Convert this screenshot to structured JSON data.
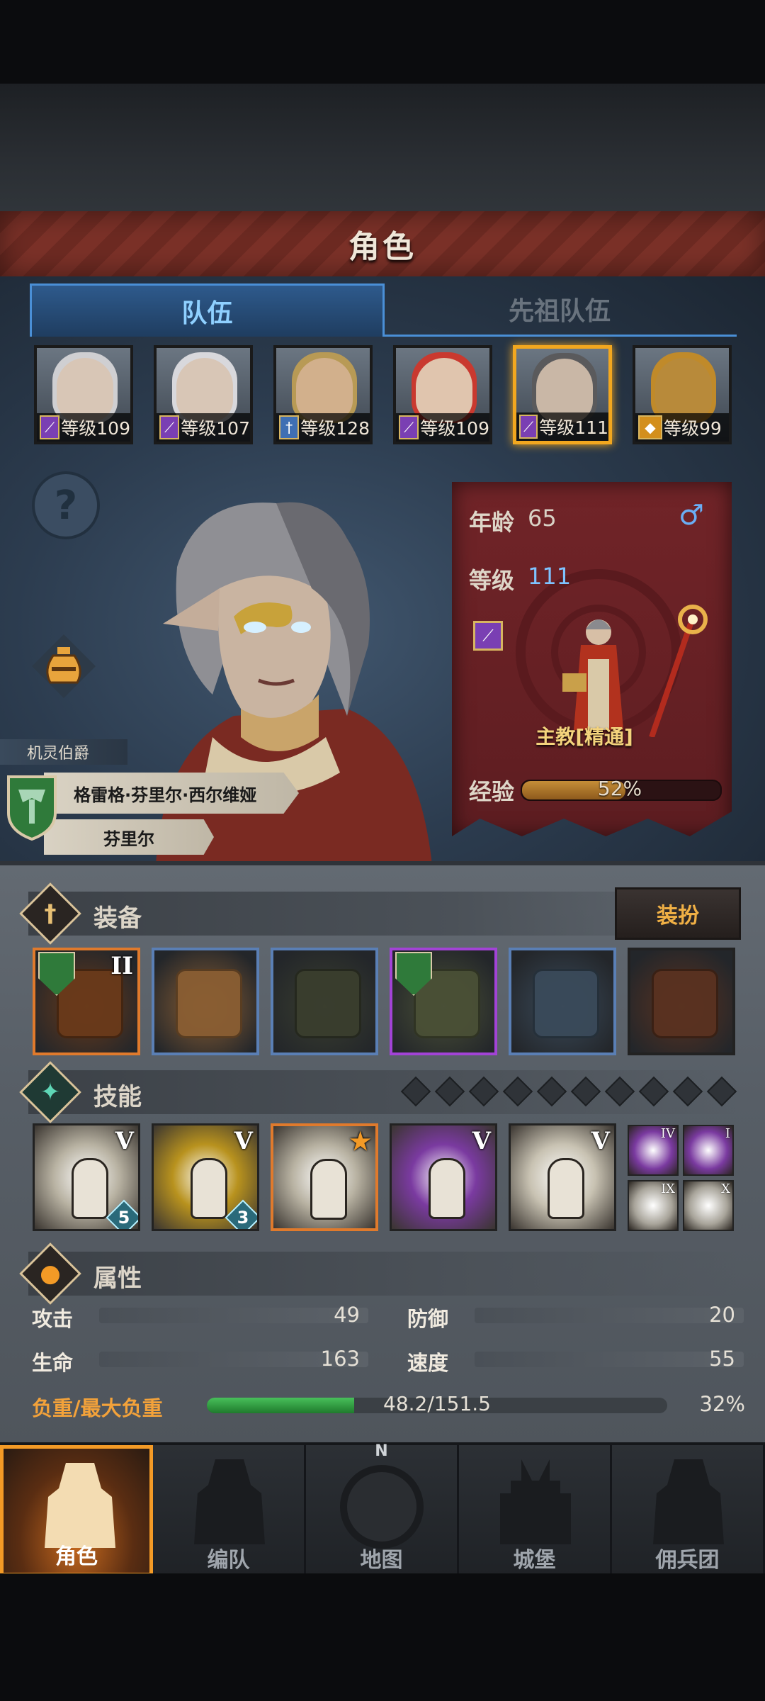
{
  "header": {
    "title": "角色"
  },
  "tabs": [
    {
      "label": "队伍",
      "active": true
    },
    {
      "label": "先祖队伍",
      "active": false
    }
  ],
  "roster": [
    {
      "level": "等级109",
      "class_icon": "staff-icon",
      "face": "#d8c6b6",
      "hair": "#cfcfd2"
    },
    {
      "level": "等级107",
      "class_icon": "staff-icon",
      "face": "#d8c6b6",
      "hair": "#d8d8dc"
    },
    {
      "level": "等级128",
      "class_icon": "sword-icon",
      "face": "#d2b08c",
      "hair": "#b89a55"
    },
    {
      "level": "等级109",
      "class_icon": "staff-icon",
      "face": "#e0c5ae",
      "hair": "#c9392f"
    },
    {
      "level": "等级111",
      "class_icon": "staff-icon",
      "face": "#c9b7a6",
      "hair": "#5a5a5c",
      "selected": true
    },
    {
      "level": "等级99",
      "class_icon": "shield-icon",
      "face": "#b88a3a",
      "hair": "#c08a2a"
    }
  ],
  "character": {
    "rank": "机灵伯爵",
    "full_name": "格雷格·芬里尔·西尔维娅",
    "short_name": "芬里尔",
    "age_label": "年龄",
    "age": "65",
    "level_label": "等级",
    "level": "111",
    "class_name": "主教[精通]",
    "exp_label": "经验",
    "exp_percent": "52%",
    "exp_fraction": 0.52,
    "gender_icon": "male-symbol-icon"
  },
  "equipment": {
    "title": "装备",
    "outfit_button": "装扮",
    "slots": [
      {
        "name": "staff",
        "rank": "II",
        "border": "#e07a2c",
        "bg": "#6a3a1a"
      },
      {
        "name": "wooden-box",
        "rank": "",
        "border": "#5a7fb5",
        "bg": "#8a5e33"
      },
      {
        "name": "hood",
        "rank": "",
        "border": "#5a7fb5",
        "bg": "#3a3e2e"
      },
      {
        "name": "fur-armor",
        "rank": "",
        "border": "#a243d6",
        "bg": "#4a5036"
      },
      {
        "name": "boots",
        "rank": "",
        "border": "#5a7fb5",
        "bg": "#3a4a5a"
      },
      {
        "name": "book",
        "rank": "",
        "border": "#222222",
        "bg": "#5a3220"
      }
    ]
  },
  "skills": {
    "title": "技能",
    "points": 10,
    "slots": [
      {
        "name": "spear-summon",
        "rank": "V",
        "badge": "5",
        "bg": "#b8b2a2"
      },
      {
        "name": "holy-shield",
        "rank": "V",
        "badge": "3",
        "bg": "#b8921e"
      },
      {
        "name": "crystal-summon",
        "rank": "★",
        "badge": "",
        "bg": "#b8b2a2",
        "border": "#e07a2c"
      },
      {
        "name": "crystal-prayer-purple",
        "rank": "V",
        "badge": "",
        "bg": "#7a3aa0"
      },
      {
        "name": "crystal-prayer",
        "rank": "V",
        "badge": "",
        "bg": "#c8c2b2"
      }
    ],
    "passives": [
      {
        "name": "shield-passive",
        "rank": "IV",
        "bg": "#7a3aa0"
      },
      {
        "name": "staff-passive",
        "rank": "I",
        "bg": "#7a3aa0"
      },
      {
        "name": "burst-passive",
        "rank": "IX",
        "bg": "#a8a49a"
      },
      {
        "name": "explosion-passive",
        "rank": "X",
        "bg": "#a8a49a"
      }
    ]
  },
  "attributes": {
    "title": "属性",
    "attack_label": "攻击",
    "attack": "49",
    "defense_label": "防御",
    "defense": "20",
    "hp_label": "生命",
    "hp": "163",
    "speed_label": "速度",
    "speed": "55",
    "weight_label": "负重/最大负重",
    "weight": "48.2/151.5",
    "weight_percent": "32%",
    "weight_fraction": 0.32
  },
  "nav": [
    {
      "label": "角色",
      "icon": "knight-icon",
      "active": true
    },
    {
      "label": "编队",
      "icon": "helmet-icon",
      "active": false
    },
    {
      "label": "地图",
      "icon": "compass-icon",
      "active": false,
      "compass_letter": "N"
    },
    {
      "label": "城堡",
      "icon": "castle-icon",
      "active": false
    },
    {
      "label": "佣兵团",
      "icon": "mercenary-icon",
      "active": false
    }
  ]
}
